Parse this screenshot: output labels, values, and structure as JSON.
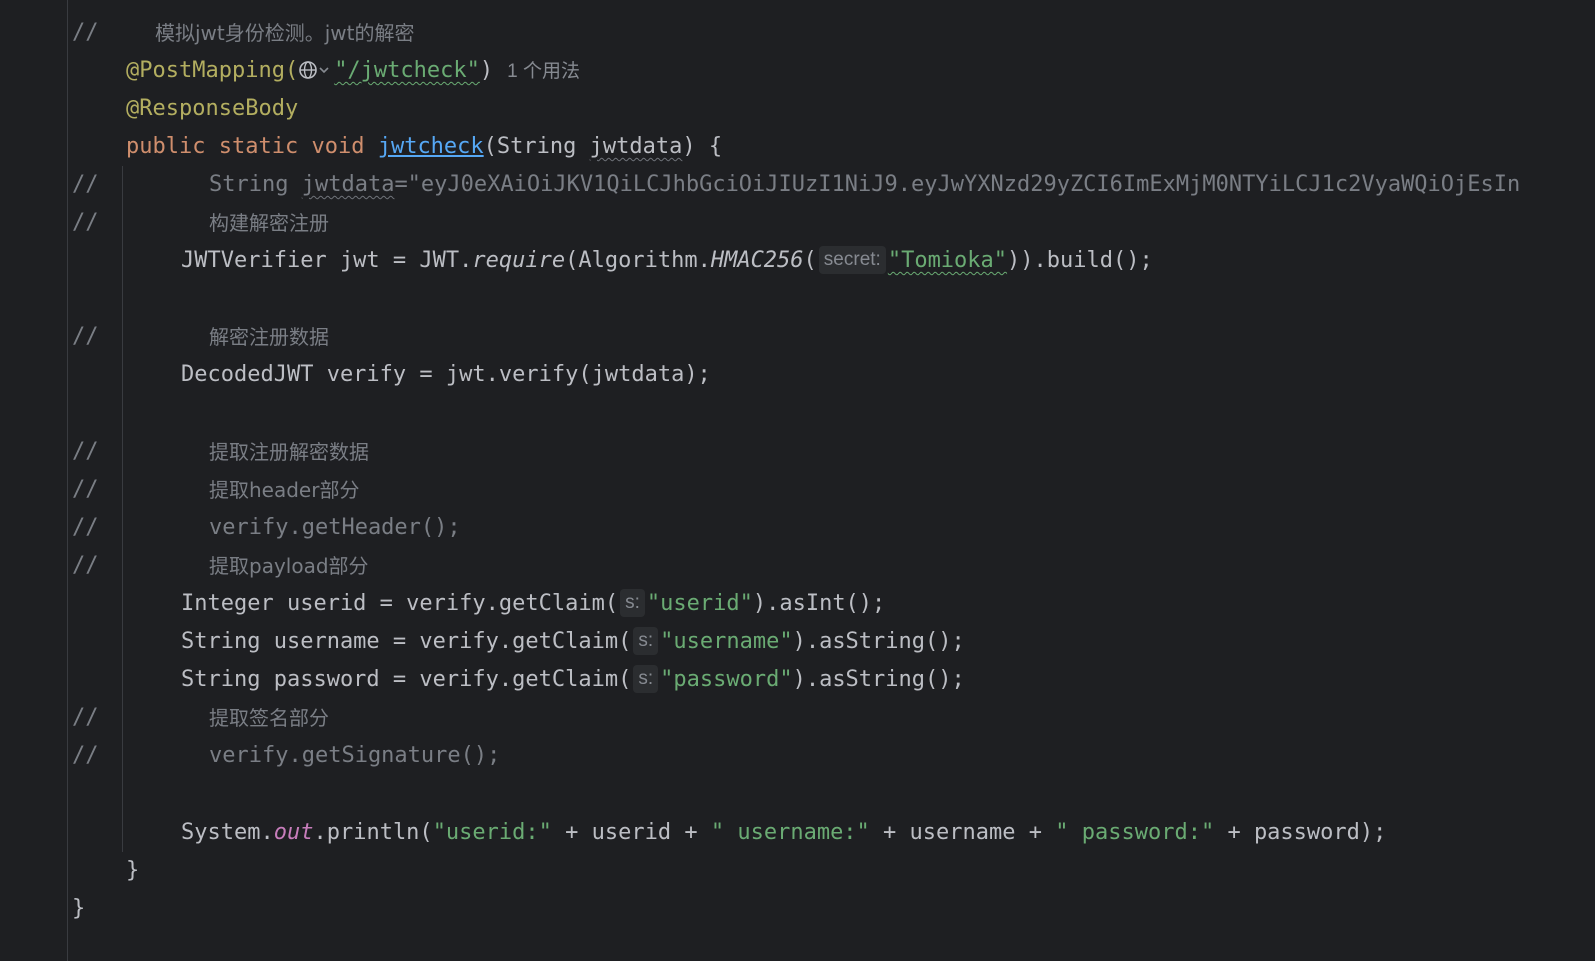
{
  "editor": {
    "comment_marker": "//",
    "line1": {
      "comment": "模拟jwt身份检测。jwt的解密"
    },
    "line2": {
      "annotation": "@PostMapping(",
      "path": "\"/jwtcheck\"",
      "close": ")",
      "usages": "1 个用法"
    },
    "line3": {
      "annotation": "@ResponseBody"
    },
    "line4": {
      "kw1": "public",
      "kw2": "static",
      "kw3": "void",
      "method": "jwtcheck",
      "params_open": "(String ",
      "param": "jwtdata",
      "params_close": ") {"
    },
    "line5": {
      "type": "String ",
      "var": "jwtdata",
      "rest": "=\"eyJ0eXAiOiJKV1QiLCJhbGciOiJIUzI1NiJ9.eyJwYXNzd29yZCI6ImExMjM0NTYiLCJ1c2VyaWQiOjEsIn"
    },
    "line6": {
      "comment": "构建解密注册"
    },
    "line7": {
      "pre": "JWTVerifier jwt = JWT.",
      "method": "require",
      "mid": "(Algorithm.",
      "const": "HMAC256",
      "open": "(",
      "hint": "secret:",
      "value": "\"Tomioka\"",
      "post": ")).build();"
    },
    "line9": {
      "comment": "解密注册数据"
    },
    "line10": {
      "code": "DecodedJWT verify = jwt.verify(jwtdata);"
    },
    "line12": {
      "comment": "提取注册解密数据"
    },
    "line13": {
      "comment": "提取header部分"
    },
    "line14": {
      "code": "verify.getHeader();"
    },
    "line15": {
      "comment": "提取payload部分"
    },
    "line16": {
      "pre": "Integer userid = verify.getClaim(",
      "hint": "s:",
      "value": "\"userid\"",
      "post": ").asInt();"
    },
    "line17": {
      "pre": "String username = verify.getClaim(",
      "hint": "s:",
      "value": "\"username\"",
      "post": ").asString();"
    },
    "line18": {
      "pre": "String password = verify.getClaim(",
      "hint": "s:",
      "value": "\"password\"",
      "post": ").asString();"
    },
    "line19": {
      "comment": "提取签名部分"
    },
    "line20": {
      "code": "verify.getSignature();"
    },
    "line22": {
      "pre": "System.",
      "field": "out",
      "println": ".println(",
      "s1": "\"userid:\"",
      "p1": " + userid + ",
      "s2": "\" username:\"",
      "p2": " + username + ",
      "s3": "\" password:\"",
      "p3": " + password);"
    },
    "line23": {
      "code": "}"
    },
    "line24": {
      "code": "}"
    }
  },
  "colors": {
    "background": "#1e1f22",
    "comment": "#7a7e85",
    "keyword": "#cf8e6d",
    "annotation": "#b3ae60",
    "string": "#6aab73",
    "method": "#56a8f5",
    "field": "#c77dbb",
    "text": "#bcbec4"
  }
}
